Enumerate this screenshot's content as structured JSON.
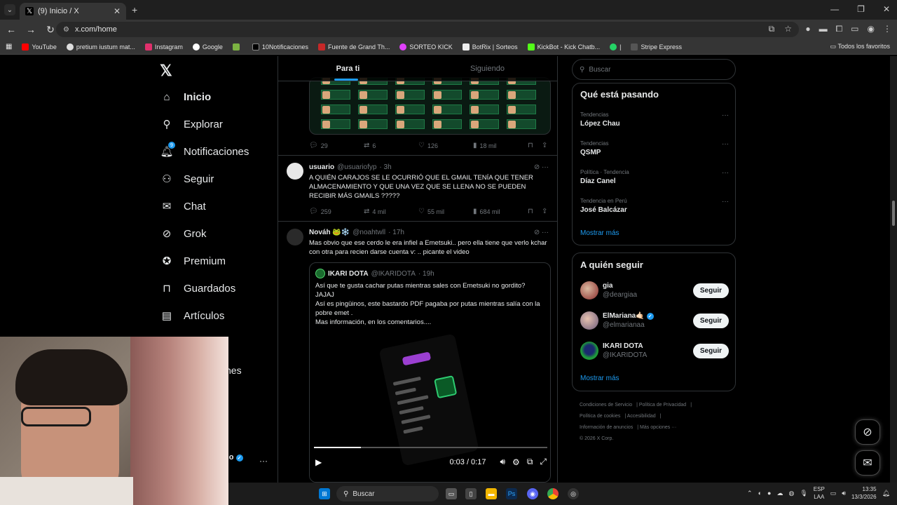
{
  "browser": {
    "tab_title": "(9) Inicio / X",
    "url": "x.com/home",
    "bookmarks": [
      "YouTube",
      "pretium iustum mat...",
      "Instagram",
      "Google",
      "10Notificaciones",
      "Fuente de Grand Th...",
      "SORTEO KICK",
      "BotRix | Sorteos",
      "KickBot - Kick Chatb...",
      "Stripe Express"
    ],
    "bookmarks_right": "Todos los favoritos"
  },
  "nav": {
    "items": [
      {
        "label": "Inicio",
        "icon": "home-icon"
      },
      {
        "label": "Explorar",
        "icon": "search-icon"
      },
      {
        "label": "Notificaciones",
        "icon": "bell-icon"
      },
      {
        "label": "Seguir",
        "icon": "person-add-icon"
      },
      {
        "label": "Chat",
        "icon": "mail-icon"
      },
      {
        "label": "Grok",
        "icon": "grok-icon"
      },
      {
        "label": "Premium",
        "icon": "verified-icon"
      },
      {
        "label": "Guardados",
        "icon": "bookmark-icon"
      },
      {
        "label": "Artículos",
        "icon": "article-icon"
      }
    ],
    "notification_badge": "9",
    "partial_more": "nes",
    "profile_partial": "no"
  },
  "feed": {
    "tabs": [
      "Para ti",
      "Siguiendo"
    ],
    "post1_actions": {
      "replies": "29",
      "reposts": "6",
      "likes": "126",
      "views": "18 mil"
    },
    "post2": {
      "name": "usuario",
      "handle": "@usuariofyp",
      "time": "· 3h",
      "text": "A QUIÉN CARAJOS SE LE OCURRIÓ QUE EL GMAIL TENÍA QUE TENER ALMACENAMIENTO Y QUE UNA VEZ QUE SE LLENA NO SE PUEDEN RECIBIR MÁS GMAILS ?????",
      "replies": "259",
      "reposts": "4 mil",
      "likes": "55 mil",
      "views": "684 mil"
    },
    "post3": {
      "name": "Nováh 🐸❄️",
      "handle": "@noahtwll",
      "time": "· 17h",
      "text": "Mas obvio que ese cerdo le era infiel a Emetsuki.. pero ella tiene que verlo kchar con otra para recien darse cuenta v: .. picante el video",
      "quote": {
        "name": "IKARI DOTA",
        "handle": "@IKARIDOTA",
        "time": "· 19h",
        "lines": [
          "Así que te gusta cachar putas mientras sales con Emetsuki no gordito?",
          "JAJAJ",
          "Así es pingüinos, este bastardo PDF pagaba por putas mientras salía con la pobre emet .",
          "Mas información, en los comentarios...."
        ]
      },
      "video_time": "0:03 / 0:17",
      "video_progress": 0.2
    }
  },
  "sidebar": {
    "search_placeholder": "Buscar",
    "trends_title": "Qué está pasando",
    "trends": [
      {
        "context": "Tendencias",
        "name": "López Chau"
      },
      {
        "context": "Tendencias",
        "name": "QSMP"
      },
      {
        "context": "Política · Tendencia",
        "name": "Díaz Canel"
      },
      {
        "context": "Tendencia en Perú",
        "name": "José Balcázar"
      }
    ],
    "show_more": "Mostrar más",
    "follow_title": "A quién seguir",
    "follow": [
      {
        "name": "gia",
        "handle": "@deargiaa",
        "verified": false
      },
      {
        "name": "ElMariana🤙🏻",
        "handle": "@elmarianaa",
        "verified": true
      },
      {
        "name": "IKARI DOTA",
        "handle": "@IKARIDOTA",
        "verified": false
      }
    ],
    "follow_button": "Seguir",
    "show_more_follow": "Mostrar más",
    "footer": [
      "Condiciones de Servicio",
      "Política de Privacidad",
      "Política de cookies",
      "Accesibilidad",
      "Información de anuncios",
      "Más opciones ···",
      "© 2026 X Corp."
    ]
  },
  "taskbar": {
    "search": "Buscar",
    "lang_top": "ESP",
    "lang_bottom": "LAA",
    "time": "13:35",
    "date": "13/3/2026"
  },
  "colors": {
    "accent": "#1d9bf0",
    "background": "#000000",
    "border": "#2f3336",
    "muted": "#71767b"
  }
}
